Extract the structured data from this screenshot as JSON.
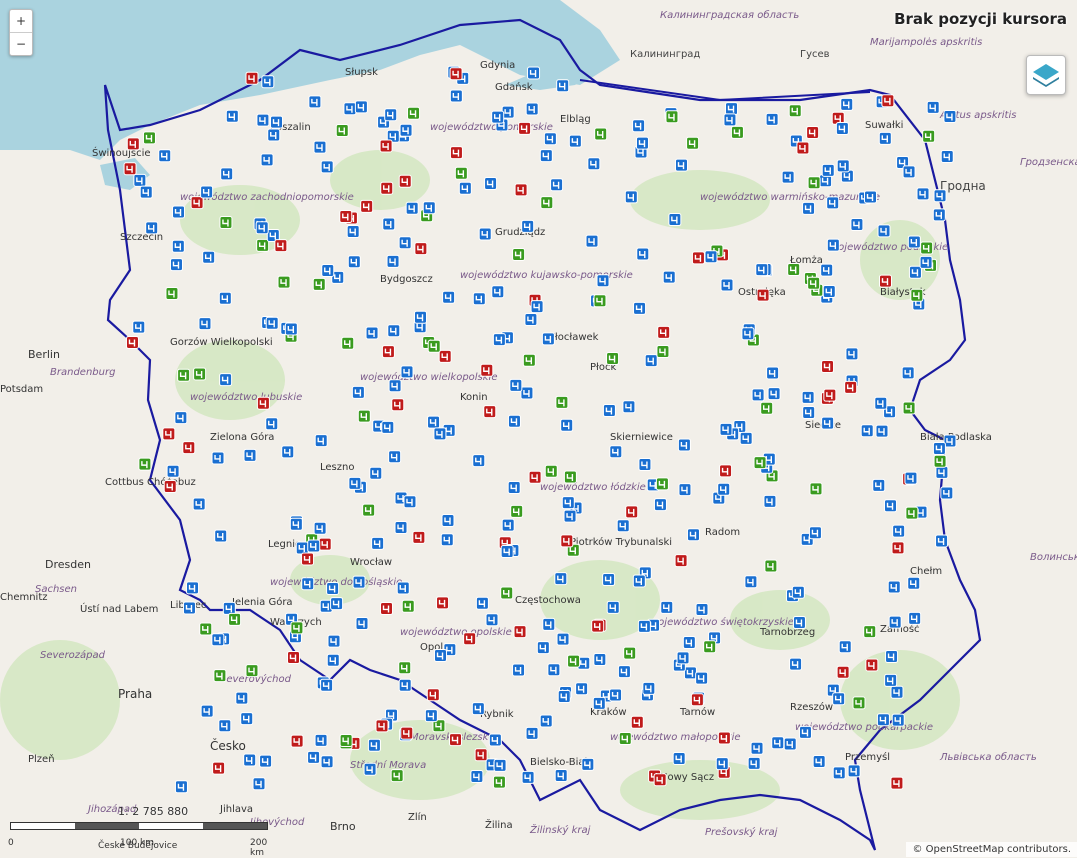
{
  "cursor_status": "Brak pozycji kursora",
  "zoom": {
    "in_label": "+",
    "out_label": "−"
  },
  "layers_button": {
    "icon": "layers-icon"
  },
  "scale": {
    "ratio": "1: 2 785 880",
    "ticks": [
      "0",
      "100 km",
      "200 km"
    ]
  },
  "attribution": "© OpenStreetMap contributors.",
  "colors": {
    "land": "#f2efe9",
    "water": "#aad3df",
    "border": "#1a1aa0",
    "marker_blue": "#1a6fd1",
    "marker_green": "#3a9b1f",
    "marker_red": "#c01b1b",
    "forest": "#cde6b8"
  },
  "place_labels": {
    "kaliningrad_region": "Калининградская область",
    "kaliningrad": "Калининград",
    "gusev": "Гусев",
    "marijampoles": "Marijampolės apskritis",
    "alytus": "Alytus apskritis",
    "grodno_region": "Гродзенская вобласць",
    "grodno": "Гродна",
    "gdansk": "Gdańsk",
    "gdynia": "Gdynia",
    "elblag": "Elbląg",
    "suwalki": "Suwałki",
    "pomorskie": "województwo pomorskie",
    "warminsko": "województwo warmińsko-mazurskie",
    "podlaskie": "województwo podlaskie",
    "zachodniopomorskie": "województwo zachodniopomorskie",
    "swinoujscie": "Świnoujście",
    "koszalin": "Koszalin",
    "slupsk": "Słupsk",
    "szczecin": "Szczecin",
    "grudziadz": "Grudziądz",
    "bydgoszcz": "Bydgoszcz",
    "kujawsko": "województwo kujawsko-pomorskie",
    "lomza": "Łomża",
    "ostroleka": "Ostrołęka",
    "bialystok": "Białystok",
    "gorzow": "Gorzów Wielkopolski",
    "berlin": "Berlin",
    "potsdam": "Potsdam",
    "brandenburg": "Brandenburg",
    "wloclawek": "Włocławek",
    "plock": "Płock",
    "lubuskie": "województwo lubuskie",
    "wielkopolskie": "województwo wielkopolskie",
    "konin": "Konin",
    "zielona_gora": "Zielona Góra",
    "skierniewice": "Skierniewice",
    "siedlce": "Siedlce",
    "biala_podlaska": "Biała Podlaska",
    "cottbus": "Cottbus Chóśebuz",
    "leszno": "Leszno",
    "lodzkie": "województwo łódzkie",
    "radom": "Radom",
    "trybunalski": "Piotrków Trybunalski",
    "legnica": "Legnica",
    "wroclaw": "Wrocław",
    "dolnoslaskie": "województwo dolnośląskie",
    "jelenia": "Jelenia Góra",
    "walbrzych": "Wałbrzych",
    "opolskie": "województwo opolskie",
    "opole": "Opole",
    "czestochowa": "Częstochowa",
    "swietokrzyskie": "województwo świętokrzyskie",
    "tarnobrzeg": "Tarnobrzeg",
    "zamosc": "Zamość",
    "chelm": "Chełm",
    "volyn": "Волинська область",
    "dresden": "Dresden",
    "sachsen": "Sachsen",
    "liberec": "Liberec",
    "usti": "Ústí nad Labem",
    "chemnitz": "Chemnitz",
    "severozapad": "Severozápad",
    "severovychod": "Severovýchod",
    "praha": "Praha",
    "cesko": "Česko",
    "moravskoslezsko": "Moravskoslezsko",
    "stredni_morava": "Střední Morava",
    "plzen": "Plzeň",
    "jihlava": "Jihlava",
    "jihovychod": "Jihovýchod",
    "jihozapad": "Jihozápad",
    "brno": "Brno",
    "zlin": "Zlín",
    "zilina": "Žilina",
    "zilinsky": "Žilinský kraj",
    "presovsky": "Prešovský kraj",
    "ceske_budejovice": "České Budějovice",
    "bielsko": "Bielsko-Biała",
    "rybnik": "Rybnik",
    "malopolskie": "województwo małopolskie",
    "podkarpackie": "województwo podkarpackie",
    "nowy_sacz": "Nowy Sącz",
    "przemysl": "Przemyśl",
    "lviv_region": "Львівська область",
    "krakow": "Kraków",
    "tarnow": "Tarnów",
    "rzeszow": "Rzeszów"
  }
}
